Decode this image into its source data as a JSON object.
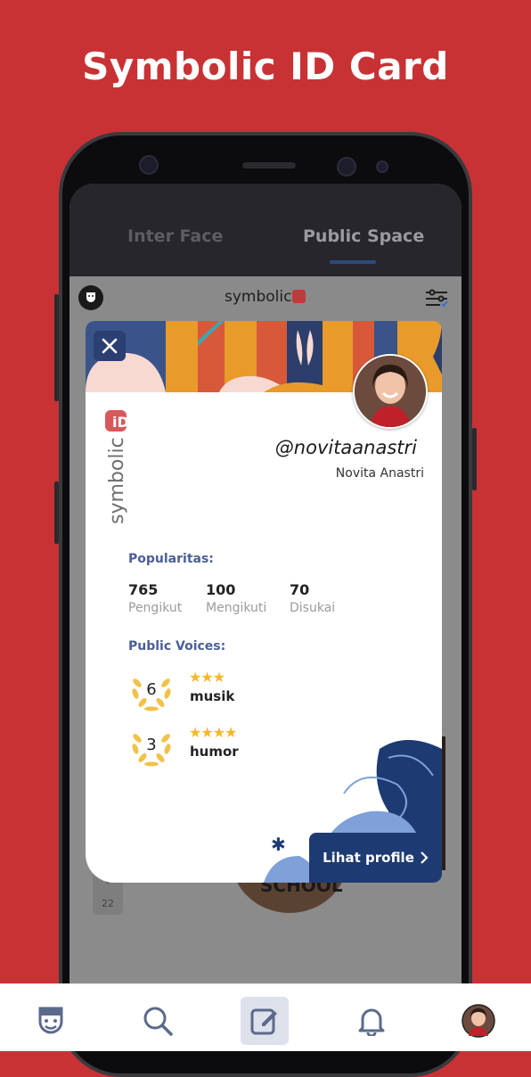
{
  "headline": "Symbolic ID Card",
  "tabs": [
    {
      "label": "Inter Face"
    },
    {
      "label": "Public Space"
    }
  ],
  "appbar": {
    "brand": "symbolic"
  },
  "feed": {
    "image_caption": "SCHOOL",
    "vote_count": "22"
  },
  "card": {
    "handle": "@novitaanastri",
    "full_name": "Novita Anastri",
    "popularity_label": "Popularitas:",
    "stats": [
      {
        "value": "765",
        "label": "Pengikut"
      },
      {
        "value": "100",
        "label": "Mengikuti"
      },
      {
        "value": "70",
        "label": "Disukai"
      }
    ],
    "voices_label": "Public Voices:",
    "voices": [
      {
        "rank": "6",
        "stars": 3,
        "topic": "musik"
      },
      {
        "rank": "3",
        "stars": 4,
        "topic": "humor"
      }
    ],
    "profile_button": "Lihat profile"
  },
  "bottom_nav": [
    {
      "icon": "symbolic-face-icon",
      "active": false
    },
    {
      "icon": "search-icon",
      "active": false
    },
    {
      "icon": "edit-icon",
      "active": true
    },
    {
      "icon": "bell-icon",
      "active": false
    },
    {
      "icon": "avatar",
      "active": false
    }
  ],
  "colors": {
    "background": "#c83235",
    "accent_blue": "#1e3a72",
    "section_label": "#4a5f96",
    "star": "#f4b82a"
  }
}
